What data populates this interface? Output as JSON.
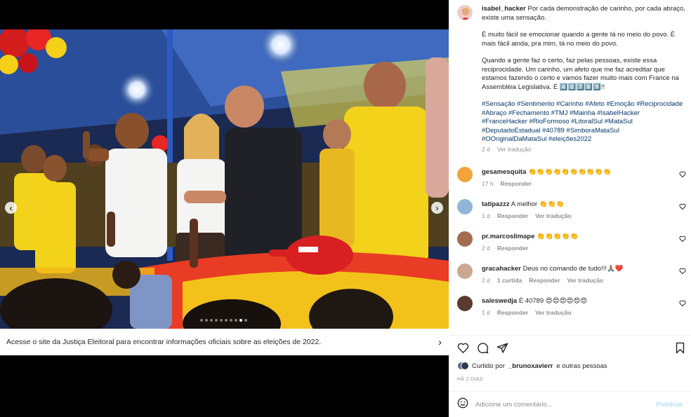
{
  "post": {
    "author": "isabel_hacker",
    "caption_paragraphs": [
      "Por cada demonstração de carinho, por cada abraço, existe uma sensação.",
      "É muito fácil se emocionar quando a gente tá no meio do povo. É mais fácil ainda, pra mim, tá no meio do povo.",
      "Quando a gente faz o certo, faz pelas pessoas, existe essa reciprocidade. Um carinho, um afeto que me faz acreditar que estamos fazendo o certo e vamos fazer muito mais com France na Assembléia Legislativa. É 4️⃣0️⃣7️⃣8️⃣9️⃣!!"
    ],
    "hashtags": "#Sensação #Sentimento #Carinho #Afeto #Emoção #Reciprocidade #Abraço #Fechamento #TMJ #Mainha #IsabelHacker #FranceHacker #RioFormoso #LitoralSul #MataSul #DeputadoEstadual #40789 #SimboraMataSul #OOriginalDaMataSul #eleições2022",
    "time": "2 d",
    "see_translation": "Ver tradução"
  },
  "comments": [
    {
      "user": "gesamesquita",
      "text": "👏👏👏👏👏👏👏👏👏👏",
      "time": "17 h",
      "likes": "",
      "reply": "Responder",
      "translate": ""
    },
    {
      "user": "tatipazzz",
      "text": "A melhor 👏👏👏",
      "time": "1 d",
      "likes": "",
      "reply": "Responder",
      "translate": "Ver tradução"
    },
    {
      "user": "pr.marcoslimape",
      "text": "👏👏👏👏👏",
      "time": "2 d",
      "likes": "",
      "reply": "Responder",
      "translate": ""
    },
    {
      "user": "gracahacker",
      "text": "Deus no comando de tudo!!!🙏🏽❤️",
      "time": "2 d",
      "likes": "1 curtida",
      "reply": "Responder",
      "translate": "Ver tradução"
    },
    {
      "user": "saleswedja",
      "text": "É 40789 😍😍😍😍😍😍",
      "time": "1 d",
      "likes": "",
      "reply": "Responder",
      "translate": "Ver tradução"
    }
  ],
  "liked_by": {
    "prefix": "Curtido por",
    "user": "_brunoxavierr",
    "suffix": "e outras pessoas"
  },
  "posted": "HÁ 2 DIAS",
  "comment_box": {
    "placeholder": "Adicione um comentário...",
    "publish": "Publicar"
  },
  "banner": {
    "text": "Acesse o site da Justiça Eleitoral para encontrar informações oficiais sobre as eleições de 2022."
  },
  "carousel": {
    "total": 10,
    "active_index": 8
  },
  "icons": {
    "like": "heart-icon",
    "comment": "comment-icon",
    "share": "share-icon",
    "save": "bookmark-icon",
    "emoji": "emoji-icon",
    "prev": "chevron-left-icon",
    "next": "chevron-right-icon",
    "banner": "chevron-right-icon"
  },
  "colors": {
    "hashtag": "#00376b",
    "meta": "#8e8e8e",
    "publish": "#b2dffc",
    "shirt_yellow": "#f2d21b"
  }
}
